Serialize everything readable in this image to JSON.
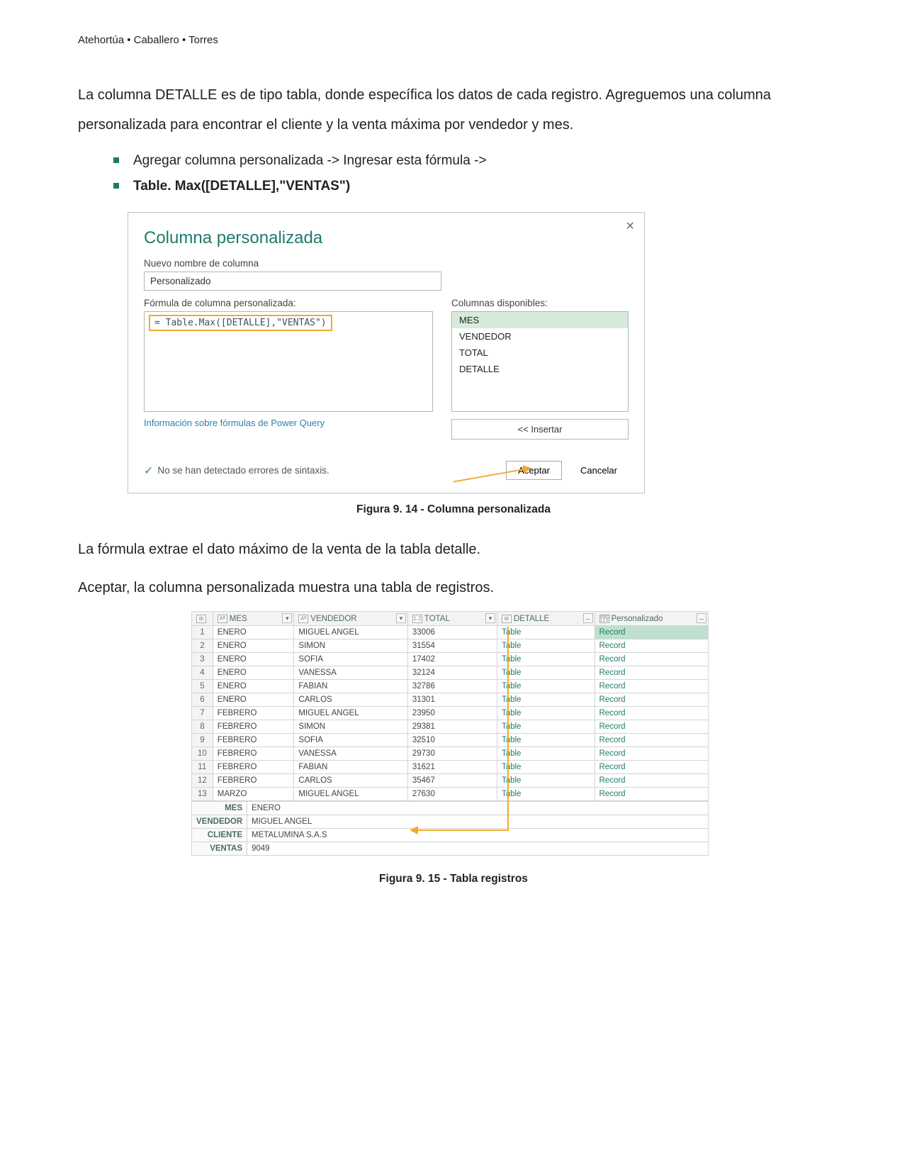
{
  "running_head": "Atehortúa • Caballero • Torres",
  "para1": "La columna DETALLE es de tipo tabla, donde específica los datos de cada registro. Agreguemos una columna personalizada para encontrar el cliente y la venta máxima por vendedor y mes.",
  "bullets": {
    "b1": "Agregar columna personalizada -> Ingresar esta fórmula ->",
    "b2": "Table. Max([DETALLE],\"VENTAS\")"
  },
  "dialog": {
    "title": "Columna personalizada",
    "name_label": "Nuevo nombre de columna",
    "name_value": "Personalizado",
    "formula_label": "Fórmula de columna personalizada:",
    "formula_value": "= Table.Max([DETALLE],\"VENTAS\")",
    "avail_label": "Columnas disponibles:",
    "avail": [
      "MES",
      "VENDEDOR",
      "TOTAL",
      "DETALLE"
    ],
    "insert": "<< Insertar",
    "info_link": "Información sobre fórmulas de Power Query",
    "syntax_ok": "No se han detectado errores de sintaxis.",
    "accept": "Aceptar",
    "cancel": "Cancelar",
    "close": "×"
  },
  "caption1": "Figura 9. 14 - Columna personalizada",
  "para2": "La fórmula extrae el dato máximo de la venta de la tabla detalle.",
  "para3": "Aceptar, la columna personalizada muestra una tabla de registros.",
  "table": {
    "headers": {
      "mes": "MES",
      "vendedor": "VENDEDOR",
      "total": "TOTAL",
      "detalle": "DETALLE",
      "pers": "Personalizado"
    },
    "type_prefix": {
      "abc": "AᴮC",
      "n12": "1.2",
      "tbl": "⊞",
      "mix": "ABC\n123"
    },
    "rows": [
      {
        "n": 1,
        "mes": "ENERO",
        "vend": "MIGUEL ANGEL",
        "tot": "33006",
        "det": "Table",
        "rec": "Record"
      },
      {
        "n": 2,
        "mes": "ENERO",
        "vend": "SIMON",
        "tot": "31554",
        "det": "Table",
        "rec": "Record"
      },
      {
        "n": 3,
        "mes": "ENERO",
        "vend": "SOFIA",
        "tot": "17402",
        "det": "Table",
        "rec": "Record"
      },
      {
        "n": 4,
        "mes": "ENERO",
        "vend": "VANESSA",
        "tot": "32124",
        "det": "Table",
        "rec": "Record"
      },
      {
        "n": 5,
        "mes": "ENERO",
        "vend": "FABIAN",
        "tot": "32786",
        "det": "Table",
        "rec": "Record"
      },
      {
        "n": 6,
        "mes": "ENERO",
        "vend": "CARLOS",
        "tot": "31301",
        "det": "Table",
        "rec": "Record"
      },
      {
        "n": 7,
        "mes": "FEBRERO",
        "vend": "MIGUEL ANGEL",
        "tot": "23950",
        "det": "Table",
        "rec": "Record"
      },
      {
        "n": 8,
        "mes": "FEBRERO",
        "vend": "SIMON",
        "tot": "29381",
        "det": "Table",
        "rec": "Record"
      },
      {
        "n": 9,
        "mes": "FEBRERO",
        "vend": "SOFIA",
        "tot": "32510",
        "det": "Table",
        "rec": "Record"
      },
      {
        "n": 10,
        "mes": "FEBRERO",
        "vend": "VANESSA",
        "tot": "29730",
        "det": "Table",
        "rec": "Record"
      },
      {
        "n": 11,
        "mes": "FEBRERO",
        "vend": "FABIAN",
        "tot": "31621",
        "det": "Table",
        "rec": "Record"
      },
      {
        "n": 12,
        "mes": "FEBRERO",
        "vend": "CARLOS",
        "tot": "35467",
        "det": "Table",
        "rec": "Record"
      },
      {
        "n": 13,
        "mes": "MARZO",
        "vend": "MIGUEL ANGEL",
        "tot": "27630",
        "det": "Table",
        "rec": "Record"
      }
    ],
    "record": {
      "mes_l": "MES",
      "mes_v": "ENERO",
      "vend_l": "VENDEDOR",
      "vend_v": "MIGUEL ANGEL",
      "cli_l": "CLIENTE",
      "cli_v": "METALUMINA S.A.S",
      "ven_l": "VENTAS",
      "ven_v": "9049"
    }
  },
  "caption2": "Figura 9. 15 - Tabla registros"
}
